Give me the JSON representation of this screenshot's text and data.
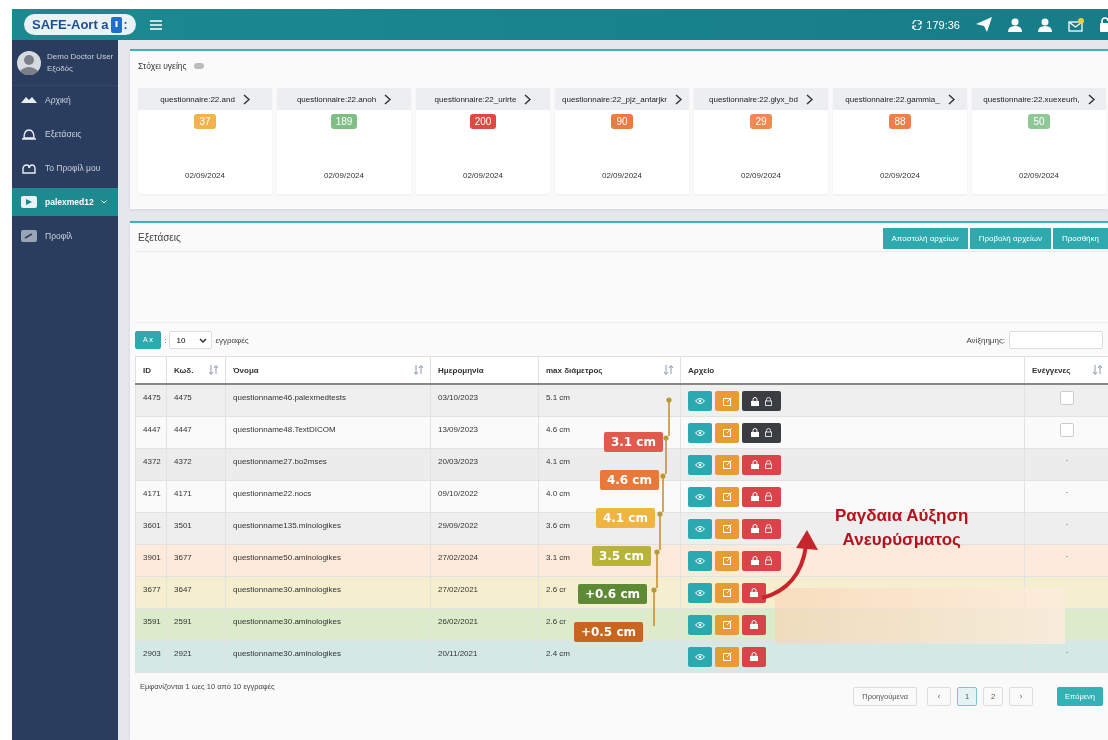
{
  "topbar": {
    "logo_text": "SAFE-Aort a",
    "logo_suffix": ":",
    "clock": "179:36",
    "mail_unread": true
  },
  "sidebar": {
    "user_name": "Demo Doctor User",
    "user_link": "Εξοδός",
    "items": [
      {
        "label": "Αρχική",
        "selected": false,
        "expandable": false
      },
      {
        "label": "Εξετάσεις",
        "selected": false,
        "expandable": false
      },
      {
        "label": "Το Προφίλ μου",
        "selected": false,
        "expandable": false
      },
      {
        "label": "palexmed12",
        "selected": true,
        "expandable": true
      },
      {
        "label": "Προφίλ",
        "selected": false,
        "expandable": false
      }
    ]
  },
  "goals": {
    "title": "Στόχει υγείης",
    "cards": [
      {
        "title": "questionnaire:22.and",
        "value": "37",
        "color": "#f2b24c",
        "date": "02/09/2024"
      },
      {
        "title": "questionnaire:22.anoh",
        "value": "189",
        "color": "#7fbf85",
        "date": "02/09/2024"
      },
      {
        "title": "questionnaire:22_urirte",
        "value": "200",
        "color": "#dc4b42",
        "date": "02/09/2024"
      },
      {
        "title": "questionnaire:22_pjz_antarjkr",
        "value": "90",
        "color": "#ec7a45",
        "date": "02/09/2024"
      },
      {
        "title": "questionnaire:22.glyx_bd",
        "value": "29",
        "color": "#ef8a52",
        "date": "02/09/2024"
      },
      {
        "title": "questionnaire:22.gammia_",
        "value": "88",
        "color": "#ee7f4b",
        "date": "02/09/2024"
      },
      {
        "title": "questionnaire:22.xuexeurh,",
        "value": "50",
        "color": "#8fc795",
        "date": "02/09/2024"
      }
    ]
  },
  "exams": {
    "title": "Εξετάσεις",
    "buttons": [
      "Αποστολή αρχείων",
      "Προβολή αρχείων",
      "Προσθήκη"
    ],
    "show_button": "A ⅹ",
    "show_separator": ":",
    "page_size": "10",
    "page_size_label": "εγγραφές",
    "search_label": "Ανίξηημης:",
    "columns": [
      {
        "label": "ID",
        "sortable": false
      },
      {
        "label": "Κωδ.",
        "sortable": true
      },
      {
        "label": "Όνομα",
        "sortable": true
      },
      {
        "label": "Ημερομηνία",
        "sortable": false
      },
      {
        "label": "max διάμετρος",
        "sortable": true
      },
      {
        "label": "Αρχείο",
        "sortable": false
      },
      {
        "label": "Ενέγγενες",
        "sortable": true
      }
    ],
    "rows": [
      {
        "id": "4475",
        "code": "4475",
        "name": "questionname46.palexmedtests",
        "date": "03/10/2023",
        "diameter": "5.1 cm",
        "color": "#efefef",
        "kind": "dark",
        "verified": {
          "kind": "checkbox",
          "checked": false
        }
      },
      {
        "id": "4447",
        "code": "4447",
        "name": "questionname48.TextDICOM",
        "date": "13/09/2023",
        "diameter": "4.6 cm",
        "color": "#fafafa",
        "kind": "dark",
        "verified": {
          "kind": "checkbox",
          "checked": false
        }
      },
      {
        "id": "4372",
        "code": "4372",
        "name": "questionname27.bo2mses",
        "date": "20/03/2023",
        "diameter": "4.1 cm",
        "color": "#ececec",
        "kind": "red",
        "verified": {
          "kind": "text",
          "text": "·"
        }
      },
      {
        "id": "4171",
        "code": "4171",
        "name": "questionname22.nocs",
        "date": "09/10/2022",
        "diameter": "4.0 cm",
        "color": "#fafafa",
        "kind": "red",
        "verified": {
          "kind": "text",
          "text": "·"
        }
      },
      {
        "id": "3601",
        "code": "3501",
        "name": "questionname135.minologikes",
        "date": "29/09/2022",
        "diameter": "3.6 cm",
        "color": "#eeeeee",
        "kind": "red",
        "verified": {
          "kind": "text",
          "text": "·"
        }
      },
      {
        "id": "3901",
        "code": "3677",
        "name": "questionname50.aminologikes",
        "date": "27/02/2024",
        "diameter": "3.1 cm",
        "color": "#fdeadb",
        "kind": "red",
        "verified": {
          "kind": "text",
          "text": "·"
        }
      },
      {
        "id": "3677",
        "code": "3647",
        "name": "questionname30.aminologikes",
        "date": "27/02/2021",
        "diameter": "2.6 cr",
        "color": "#f6efcf",
        "kind": "short",
        "verified": {
          "kind": "none"
        }
      },
      {
        "id": "3591",
        "code": "2591",
        "name": "questionname30.aminologikes",
        "date": "26/02/2021",
        "diameter": "2.6 cr",
        "color": "#dcebc9",
        "kind": "short",
        "verified": {
          "kind": "none"
        }
      },
      {
        "id": "2903",
        "code": "2921",
        "name": "questionname30.aminologikes",
        "date": "20/11/2021",
        "diameter": "2.4 cm",
        "color": "#d4e9e5",
        "kind": "short",
        "verified": {
          "kind": "text",
          "text": "·"
        }
      }
    ],
    "callouts": [
      {
        "label": "3.1 cm",
        "color": "#e05a4e"
      },
      {
        "label": "4.6 cm",
        "color": "#e8793a"
      },
      {
        "label": "4.1 cm",
        "color": "#f2b441"
      },
      {
        "label": "3.5 cm",
        "color": "#b8b33a"
      },
      {
        "label": "+0.6 cm",
        "color": "#5f8a35"
      },
      {
        "label": "+0.5 cm",
        "color": "#c8651f"
      }
    ],
    "annotation": [
      "Ραγδαια Αύξηση",
      "Ανευρύσματος"
    ],
    "footer": "Εμφανίζονται 1 ωες 10 από 10 εγγραφές",
    "pagination": {
      "previous": "Προηγούμενα",
      "prev_arrow": "‹",
      "pages": [
        {
          "label": "1",
          "selected": true
        },
        {
          "label": "2",
          "selected": false
        }
      ],
      "next_arrow": "›",
      "next": "Επόμενη"
    }
  }
}
